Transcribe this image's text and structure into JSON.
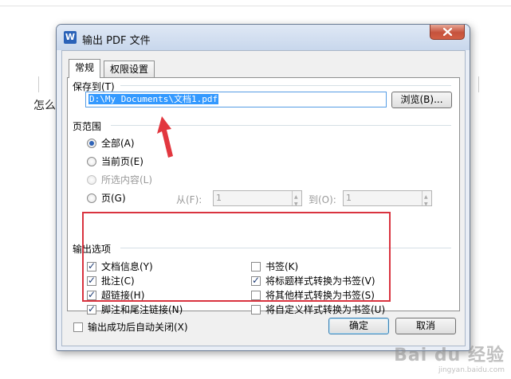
{
  "background": {
    "doc_text": "怎么"
  },
  "dialog": {
    "app_icon_letter": "W",
    "title": "输出 PDF 文件",
    "tabs": [
      {
        "label": "常规",
        "active": true
      },
      {
        "label": "权限设置",
        "active": false
      }
    ],
    "save_to": {
      "label": "保存到(T)",
      "path_value": "D:\\My Documents\\文档1.pdf",
      "browse_label": "浏览(B)..."
    },
    "page_range": {
      "label": "页范围",
      "options": [
        {
          "label": "全部(A)",
          "selected": true,
          "enabled": true
        },
        {
          "label": "当前页(E)",
          "selected": false,
          "enabled": true
        },
        {
          "label": "所选内容(L)",
          "selected": false,
          "enabled": false
        },
        {
          "label": "页(G)",
          "selected": false,
          "enabled": true
        }
      ],
      "from_label": "从(F):",
      "from_value": "1",
      "to_label": "到(O):",
      "to_value": "1"
    },
    "output_options": {
      "label": "输出选项",
      "left": [
        {
          "label": "文档信息(Y)",
          "checked": true
        },
        {
          "label": "批注(C)",
          "checked": true
        },
        {
          "label": "超链接(H)",
          "checked": true
        },
        {
          "label": "脚注和尾注链接(N)",
          "checked": true
        }
      ],
      "right": [
        {
          "label": "书签(K)",
          "checked": false
        },
        {
          "label": "将标题样式转换为书签(V)",
          "checked": true
        },
        {
          "label": "将其他样式转换为书签(S)",
          "checked": false
        },
        {
          "label": "将自定义样式转换为书签(U)",
          "checked": false
        }
      ]
    },
    "auto_close": {
      "label": "输出成功后自动关闭(X)",
      "checked": false
    },
    "ok_label": "确定",
    "cancel_label": "取消"
  },
  "watermark": {
    "brand": "Bai du 经验",
    "url": "jingyan.baidu.com"
  },
  "colors": {
    "highlight_box": "#d9333f",
    "selection": "#3399ff",
    "title_gradient_top": "#dfe8f5",
    "close_button": "#c5523c"
  }
}
